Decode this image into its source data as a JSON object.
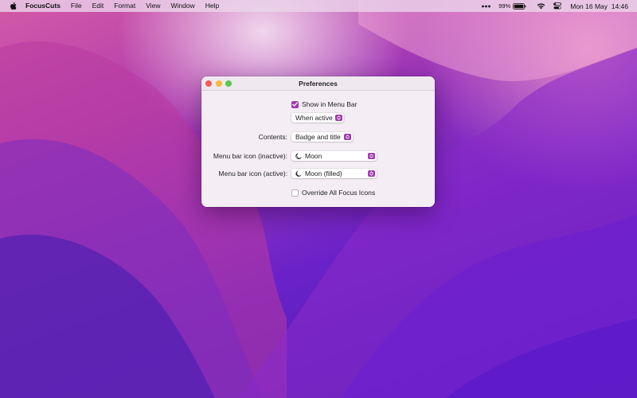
{
  "menubar": {
    "app_name": "FocusCuts",
    "menus": [
      "File",
      "Edit",
      "Format",
      "View",
      "Window",
      "Help"
    ],
    "battery_percent": "99%",
    "clock": "Mon 16 May  14:46"
  },
  "window": {
    "title": "Preferences",
    "show_in_menu_bar": {
      "label": "Show in Menu Bar",
      "checked": true
    },
    "when_popup": {
      "value": "When active"
    },
    "contents": {
      "label": "Contents:",
      "value": "Badge and title"
    },
    "icon_inactive": {
      "label": "Menu bar icon (inactive):",
      "value": "Moon",
      "icon": "moon-outline-icon"
    },
    "icon_active": {
      "label": "Menu bar icon (active):",
      "value": "Moon (filled)",
      "icon": "moon-filled-icon"
    },
    "override_icons": {
      "label": "Override All Focus Icons",
      "checked": false
    }
  },
  "colors": {
    "accent": "#a23ab0"
  }
}
